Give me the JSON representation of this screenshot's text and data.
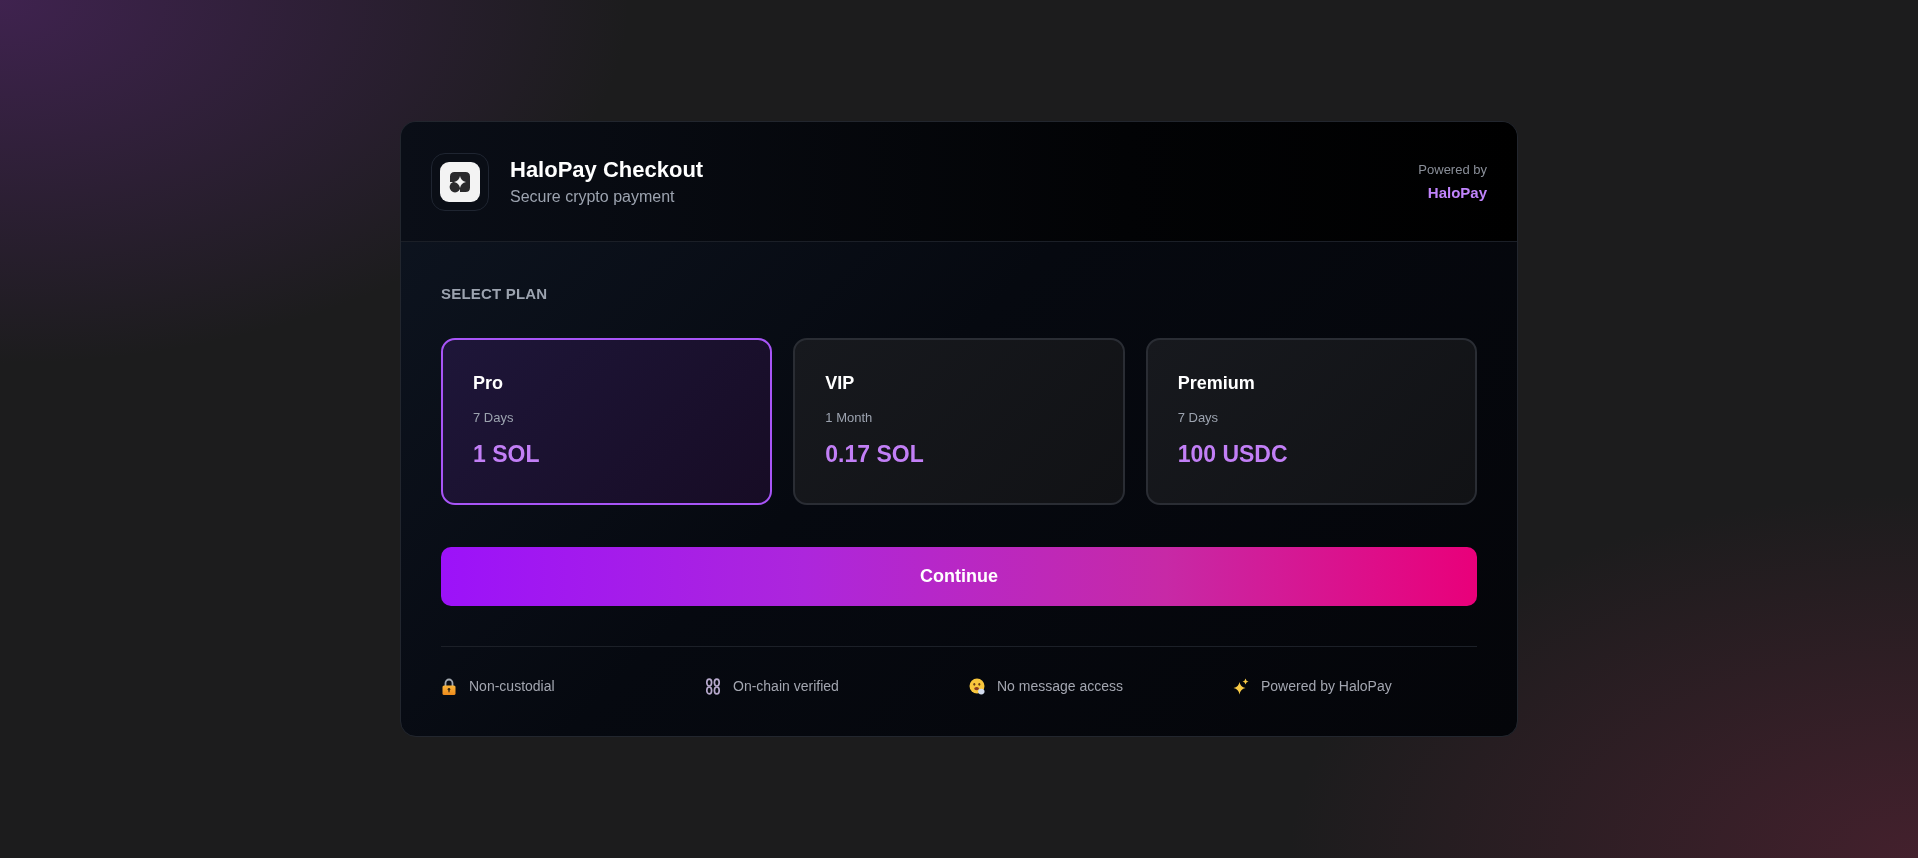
{
  "header": {
    "title": "HaloPay Checkout",
    "subtitle": "Secure crypto payment",
    "powered_by_label": "Powered by",
    "powered_by_brand": "HaloPay"
  },
  "plan_section": {
    "label": "SELECT PLAN",
    "plans": [
      {
        "name": "Pro",
        "duration": "7 Days",
        "price": "1 SOL",
        "selected": true
      },
      {
        "name": "VIP",
        "duration": "1 Month",
        "price": "0.17 SOL",
        "selected": false
      },
      {
        "name": "Premium",
        "duration": "7 Days",
        "price": "100 USDC",
        "selected": false
      }
    ]
  },
  "continue_button": {
    "label": "Continue"
  },
  "features": [
    {
      "kind": "lock",
      "label": "Non-custodial"
    },
    {
      "kind": "chain",
      "label": "On-chain verified"
    },
    {
      "kind": "face",
      "label": "No message access"
    },
    {
      "kind": "sparkles",
      "label": "Powered by HaloPay"
    }
  ]
}
